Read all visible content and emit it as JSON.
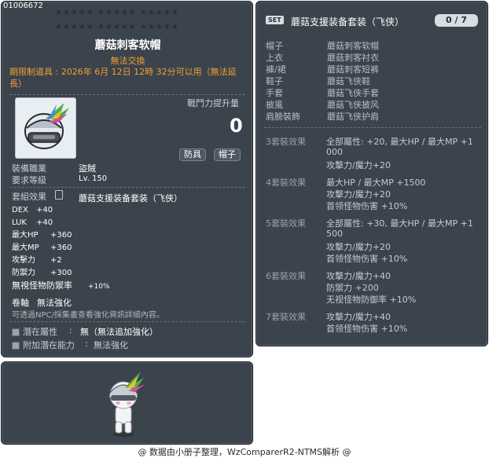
{
  "item_code": "01006672",
  "stars_row": "★★★★★  ★★★★★  ★★★★★",
  "item": {
    "name": "蘑菇刺客软帽",
    "trade_status": "無法交換",
    "expire_text": "期限制道具 : 2026年 6月 12日 12時 32分可以用（無法延長）",
    "power_label": "戰鬥力提升量",
    "power_value": "0",
    "tags": [
      "防具",
      "帽子"
    ],
    "job_label": "裝備職業",
    "job_value": "盜賊",
    "level_label": "要求等級",
    "level_value": "Lv. 150",
    "set_effect_label": "套組效果",
    "set_name": "蘑菇支援装备套装（飞侠）",
    "stats": [
      {
        "name": "DEX",
        "value": "+40"
      },
      {
        "name": "LUK",
        "value": "+40"
      },
      {
        "name": "最大HP",
        "value": "+360"
      },
      {
        "name": "最大MP",
        "value": "+360"
      },
      {
        "name": "攻擊力",
        "value": "+2"
      },
      {
        "name": "防禦力",
        "value": "+300"
      },
      {
        "name": "無視怪物防禦率",
        "value": "+10%"
      }
    ],
    "scroll_label": "卷軸",
    "scroll_value": "無法強化",
    "npc_hint": "可透過NPC/採集畫查看強化資訊詳細內容。",
    "potential_label": "潛在屬性",
    "potential_value": "無（無法追加強化）",
    "additional_label": "附加潛在能力",
    "additional_value": "無法強化"
  },
  "set": {
    "badge": "SET",
    "name": "蘑菇支援装备套装（飞侠）",
    "count": "0 / 7",
    "parts": [
      {
        "slot": "帽子",
        "name": "蘑菇刺客软帽"
      },
      {
        "slot": "上衣",
        "name": "蘑菇刺客衬衣"
      },
      {
        "slot": "褲/裙",
        "name": "蘑菇刺客短裤"
      },
      {
        "slot": "鞋子",
        "name": "蘑菇飞侠鞋"
      },
      {
        "slot": "手套",
        "name": "蘑菇飞侠手套"
      },
      {
        "slot": "披風",
        "name": "蘑菇飞侠披风"
      },
      {
        "slot": "肩膀裝飾",
        "name": "蘑菇飞侠护肩"
      }
    ],
    "effects": [
      {
        "label": "3套裝效果",
        "lines": [
          "全部屬性: +20,  最大HP / 最大MP  +1",
          "000",
          "攻擊力/魔力+20"
        ]
      },
      {
        "label": "4套裝效果",
        "lines": [
          "最大HP / 最大MP  +1500",
          "攻擊力/魔力+20",
          "首领怪物伤害  +10%"
        ]
      },
      {
        "label": "5套裝效果",
        "lines": [
          "全部屬性: +30,  最大HP / 最大MP  +1",
          "500",
          "攻擊力/魔力+20",
          "首领怪物伤害  +10%"
        ]
      },
      {
        "label": "6套裝效果",
        "lines": [
          "攻擊力/魔力+40",
          "防禦力  +200",
          "无视怪物防御率  +10%"
        ]
      },
      {
        "label": "7套裝效果",
        "lines": [
          "攻擊力/魔力+40",
          "首领怪物伤害  +10%"
        ]
      }
    ]
  },
  "footer": "@ 数据由小册子整理，WzComparerR2-NTMS解析 @"
}
